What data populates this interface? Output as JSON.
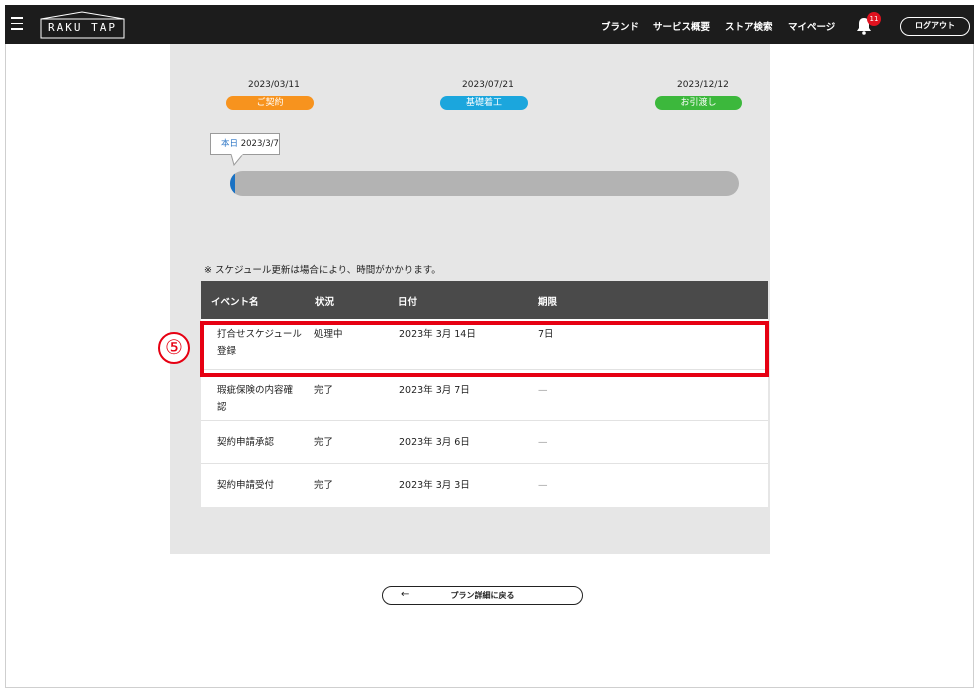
{
  "header": {
    "logo": "RAKU TAP",
    "nav": [
      "ブランド",
      "サービス概要",
      "ストア検索",
      "マイページ"
    ],
    "notification_count": "11",
    "logout_label": "ログアウト"
  },
  "timeline": {
    "milestones": [
      {
        "date": "2023/03/11",
        "label": "ご契約",
        "color": "#f7931e"
      },
      {
        "date": "2023/07/21",
        "label": "基礎着工",
        "color": "#1ba6dd"
      },
      {
        "date": "2023/12/12",
        "label": "お引渡し",
        "color": "#3cb83c"
      }
    ],
    "today_label": "本日",
    "today_date": "2023/3/7",
    "progress_percent": 1
  },
  "note": "※ スケジュール更新は場合により、時間がかかります。",
  "table": {
    "headers": [
      "イベント名",
      "状況",
      "日付",
      "期限"
    ],
    "rows": [
      {
        "event": "打合せスケジュール登録",
        "status": "処理中",
        "date": "2023年 3月 14日",
        "deadline": "7日"
      },
      {
        "event": "瑕疵保険の内容確認",
        "status": "完了",
        "date": "2023年 3月 7日",
        "deadline": "—"
      },
      {
        "event": "契約申請承認",
        "status": "完了",
        "date": "2023年 3月 6日",
        "deadline": "—"
      },
      {
        "event": "契約申請受付",
        "status": "完了",
        "date": "2023年 3月 3日",
        "deadline": "—"
      }
    ]
  },
  "annotation": {
    "step_number": "⑤"
  },
  "back_button": {
    "arrow": "←",
    "label": "プラン詳細に戻る"
  }
}
